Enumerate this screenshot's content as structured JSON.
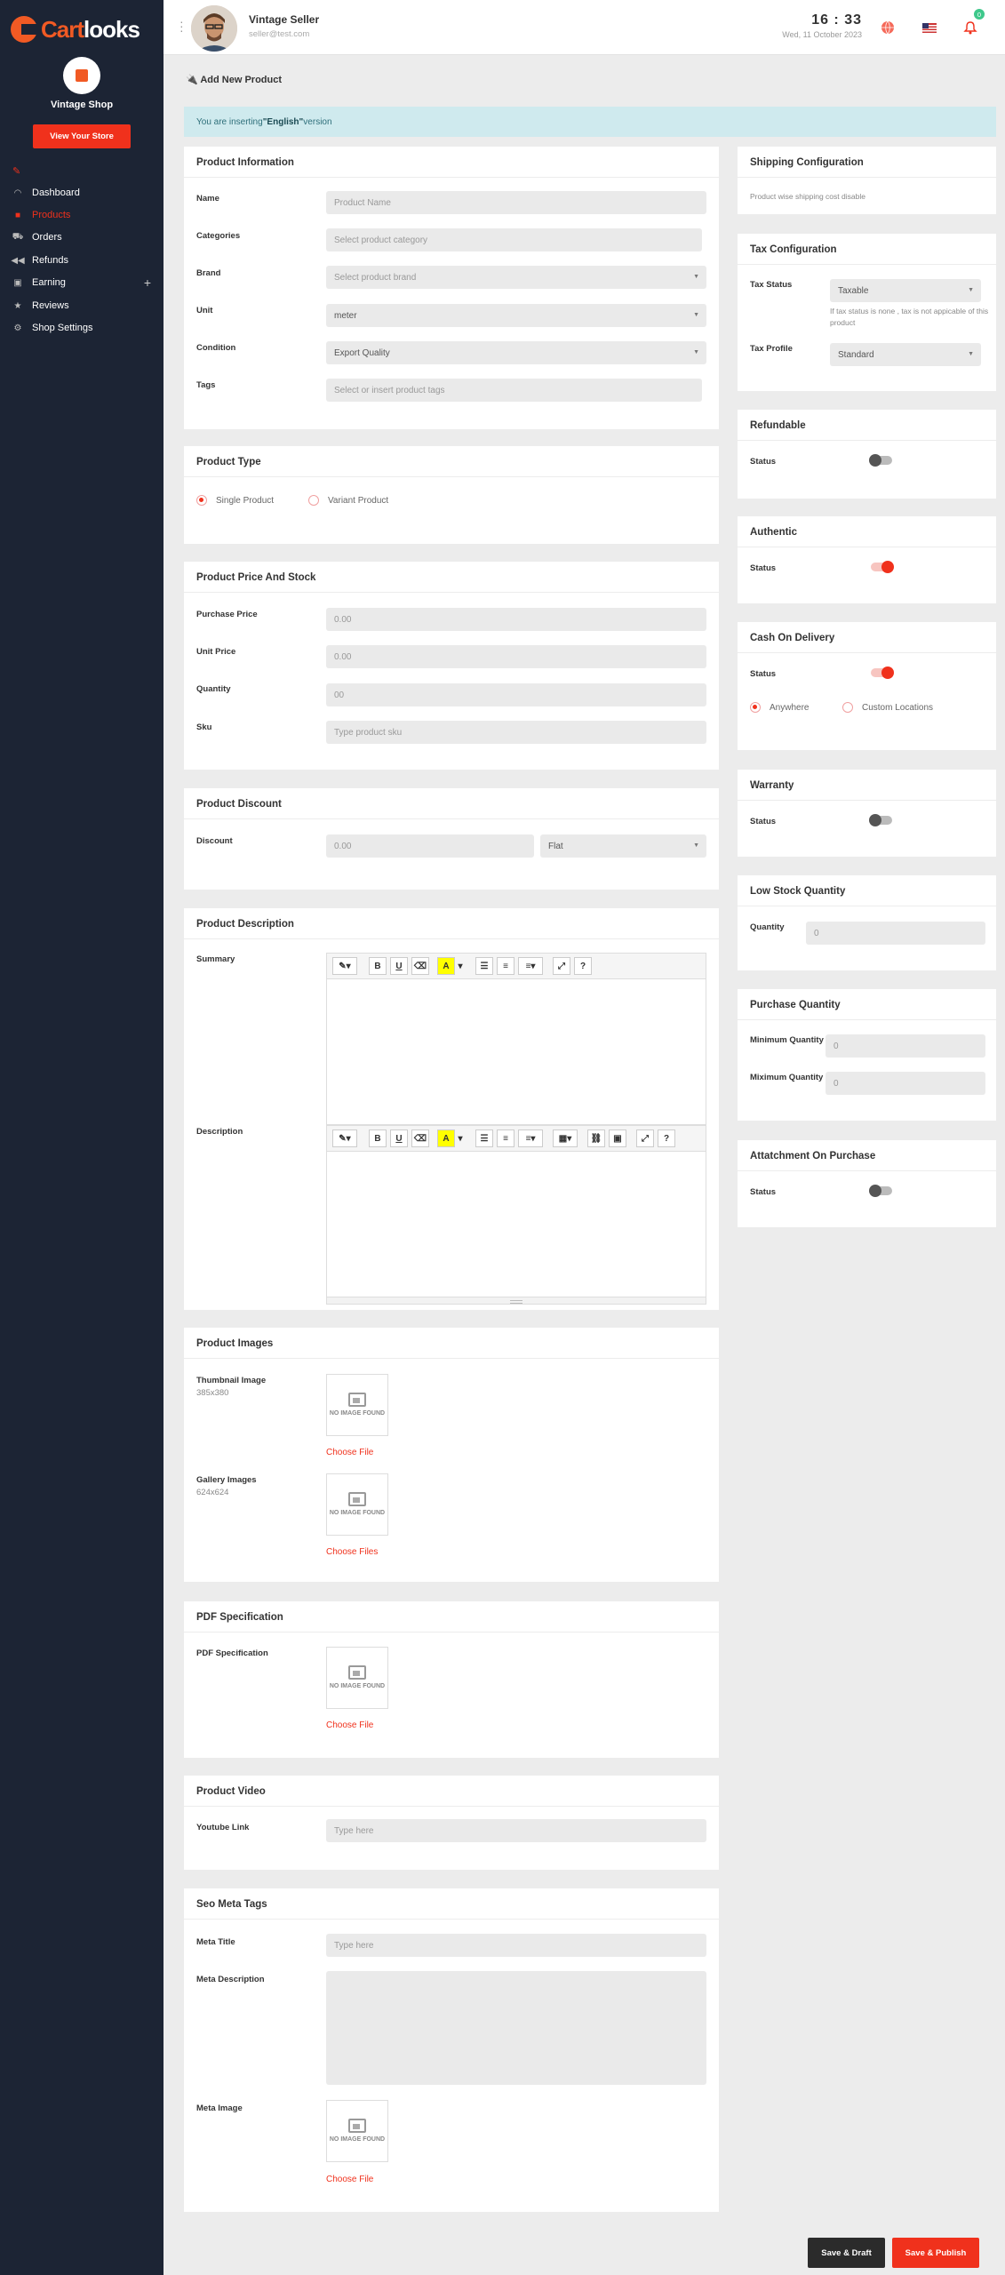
{
  "brand": {
    "logo_prefix": "Cart",
    "logo_suffix": "looks"
  },
  "sidebar": {
    "shop_name": "Vintage Shop",
    "view_store": "View Your Store",
    "items": [
      {
        "label": "Dashboard",
        "icon": "gauge-icon"
      },
      {
        "label": "Products",
        "icon": "bag-icon"
      },
      {
        "label": "Orders",
        "icon": "cart-icon"
      },
      {
        "label": "Refunds",
        "icon": "rewind-icon"
      },
      {
        "label": "Earning",
        "icon": "wallet-icon"
      },
      {
        "label": "Reviews",
        "icon": "star-icon"
      },
      {
        "label": "Shop Settings",
        "icon": "gear-icon"
      }
    ],
    "earning_expand": "+"
  },
  "header": {
    "user_name": "Vintage Seller",
    "user_email": "seller@test.com",
    "time": "16 : 33",
    "date": "Wed, 11 October 2023",
    "notif_count": "0"
  },
  "page": {
    "title": "Add New Product",
    "notice_prefix": "You are inserting ",
    "notice_lang": "\"English\"",
    "notice_suffix": " version"
  },
  "product_info": {
    "title": "Product Information",
    "name_label": "Name",
    "name_ph": "Product Name",
    "cat_label": "Categories",
    "cat_ph": "Select product category",
    "brand_label": "Brand",
    "brand_ph": "Select product brand",
    "unit_label": "Unit",
    "unit_val": "meter",
    "cond_label": "Condition",
    "cond_val": "Export Quality",
    "tags_label": "Tags",
    "tags_ph": "Select or insert product tags"
  },
  "product_type": {
    "title": "Product Type",
    "single": "Single Product",
    "variant": "Variant Product"
  },
  "price": {
    "title": "Product Price And Stock",
    "purchase_label": "Purchase Price",
    "purchase_ph": "0.00",
    "unit_label": "Unit Price",
    "unit_ph": "0.00",
    "qty_label": "Quantity",
    "qty_ph": "00",
    "sku_label": "Sku",
    "sku_ph": "Type product sku"
  },
  "discount": {
    "title": "Product Discount",
    "label": "Discount",
    "ph": "0.00",
    "type": "Flat"
  },
  "description": {
    "title": "Product Description",
    "summary_label": "Summary",
    "desc_label": "Description"
  },
  "images": {
    "title": "Product Images",
    "thumb_label": "Thumbnail Image",
    "thumb_size": "385x380",
    "gallery_label": "Gallery Images",
    "gallery_size": "624x624",
    "no_image": "NO IMAGE FOUND",
    "choose_file": "Choose File",
    "choose_files": "Choose Files"
  },
  "pdf": {
    "title": "PDF Specification",
    "label": "PDF Specification",
    "choose": "Choose File"
  },
  "video": {
    "title": "Product Video",
    "label": "Youtube Link",
    "ph": "Type here"
  },
  "seo": {
    "title": "Seo Meta Tags",
    "meta_title_label": "Meta Title",
    "meta_title_ph": "Type here",
    "meta_desc_label": "Meta Description",
    "meta_image_label": "Meta Image",
    "choose": "Choose File"
  },
  "shipping": {
    "title": "Shipping Configuration",
    "text": "Product wise shipping cost disable"
  },
  "tax": {
    "title": "Tax Configuration",
    "status_label": "Tax Status",
    "status_val": "Taxable",
    "helper": "If tax status is none , tax is not appicable of this product",
    "profile_label": "Tax Profile",
    "profile_val": "Standard"
  },
  "refundable": {
    "title": "Refundable",
    "status_label": "Status",
    "on": false
  },
  "authentic": {
    "title": "Authentic",
    "status_label": "Status",
    "on": true
  },
  "cod": {
    "title": "Cash On Delivery",
    "status_label": "Status",
    "on": true,
    "anywhere": "Anywhere",
    "custom": "Custom Locations"
  },
  "warranty": {
    "title": "Warranty",
    "status_label": "Status",
    "on": false
  },
  "low_stock": {
    "title": "Low Stock Quantity",
    "label": "Quantity",
    "ph": "0"
  },
  "purchase_qty": {
    "title": "Purchase Quantity",
    "min_label": "Minimum Quantity",
    "min_ph": "0",
    "max_label": "Miximum Quantity",
    "max_ph": "0"
  },
  "attachment": {
    "title": "Attatchment On Purchase",
    "status_label": "Status",
    "on": false
  },
  "actions": {
    "draft": "Save & Draft",
    "publish": "Save & Publish"
  },
  "colors": {
    "accent": "#f0311c",
    "sidebar": "#1c2434",
    "notice_bg": "#cfeaee",
    "badge": "#3ec88b"
  }
}
